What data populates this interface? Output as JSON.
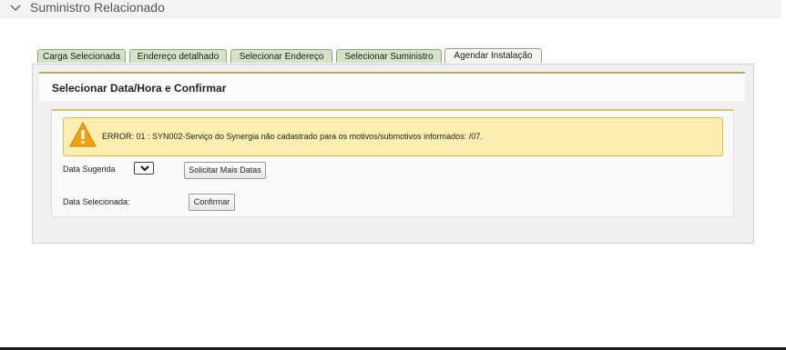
{
  "section": {
    "title": "Suministro Relacionado",
    "chevron_icon": "chevron-down-icon"
  },
  "tabs": [
    {
      "label": "Carga Selecionada",
      "active": false
    },
    {
      "label": "Endereço detalhado",
      "active": false
    },
    {
      "label": "Selecionar Endereço",
      "active": false
    },
    {
      "label": "Selecionar Suministro",
      "active": false
    },
    {
      "label": "Agendar Instalação",
      "active": true
    }
  ],
  "panel": {
    "title": "Selecionar Data/Hora e Confirmar",
    "error": {
      "icon": "warning-icon",
      "message": "ERROR: 01 : SYN002-Serviço do Synergia não cadastrado para os motivos/submotivos informados: /07."
    },
    "data_sugerida": {
      "label": "Data Sugerida",
      "select_value": "",
      "button_label": "Solicitar Mais Datas"
    },
    "data_selecionada": {
      "label": "Data Selecionada:",
      "button_label": "Confirmar"
    }
  },
  "colors": {
    "tab_bg": "#d3e3c5",
    "tab_active_bg": "#f5f5ef",
    "error_bg": "#fbeeb0",
    "error_border": "#e2b84f",
    "warning_icon": "#f0a30a"
  }
}
